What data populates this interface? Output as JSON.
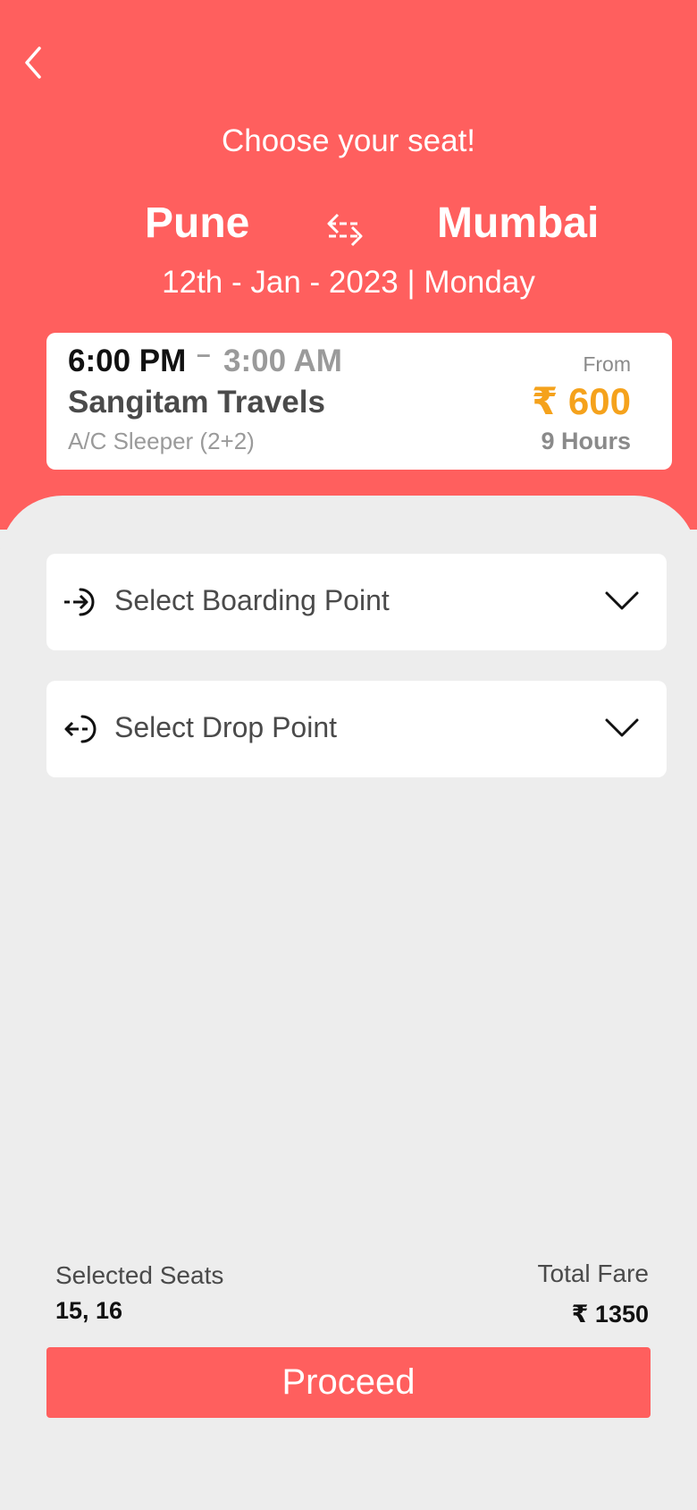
{
  "header": {
    "title": "Choose your seat!",
    "from_city": "Pune",
    "to_city": "Mumbai",
    "date": "12th - Jan - 2023 | Monday"
  },
  "bus": {
    "departure": "6:00 PM",
    "dash": "–",
    "arrival": "3:00 AM",
    "operator": "Sangitam Travels",
    "type": "A/C Sleeper (2+2)",
    "from_label": "From",
    "fare": "₹ 600",
    "duration": "9 Hours"
  },
  "boarding": {
    "label": "Select Boarding Point"
  },
  "drop": {
    "label": "Select Drop Point"
  },
  "summary": {
    "seats_label": "Selected Seats",
    "seats_value": "15, 16",
    "total_label": "Total Fare",
    "total_value": "₹ 1350"
  },
  "proceed_label": "Proceed",
  "colors": {
    "brand": "#ff5f5e",
    "fare": "#f5a21c",
    "background": "#ededed"
  },
  "icons": [
    "back-arrow-icon",
    "swap-icon",
    "boarding-icon",
    "drop-icon",
    "chevron-down-icon"
  ]
}
